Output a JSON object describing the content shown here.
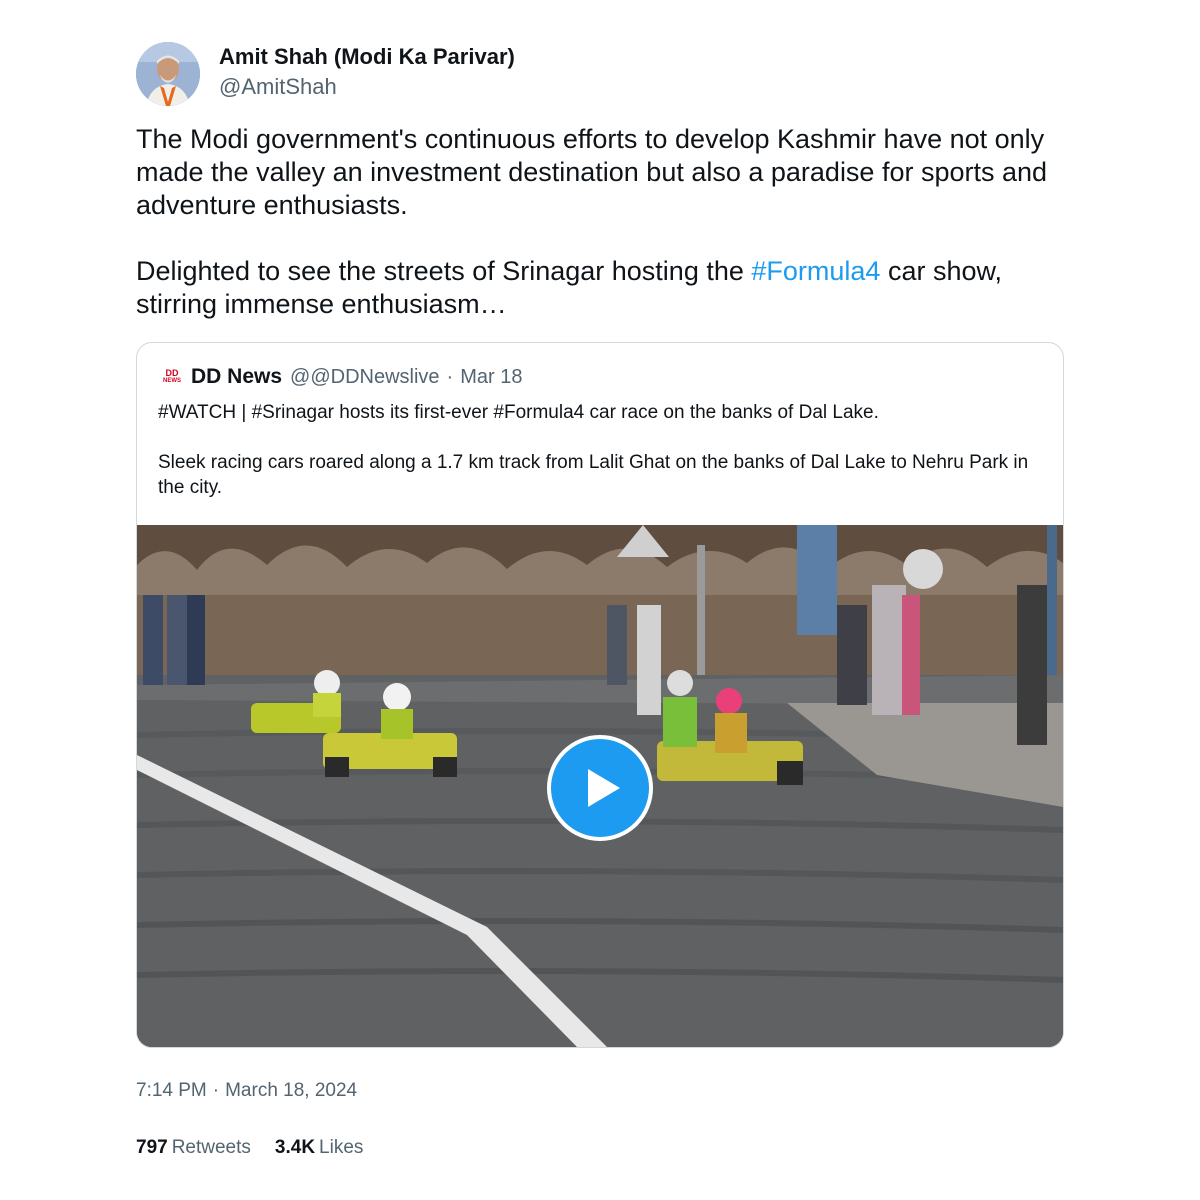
{
  "author": {
    "display_name": "Amit Shah (Modi Ka Parivar)",
    "handle": "@AmitShah",
    "avatar_icon": "profile-photo"
  },
  "tweet": {
    "paragraph1": "The Modi government's continuous efforts to develop Kashmir have not only made the valley an investment destination but also a paradise for sports and adventure enthusiasts.",
    "paragraph2_before": "Delighted to see the streets of Srinagar hosting the ",
    "paragraph2_hashtag": "#Formula4",
    "paragraph2_after": " car show, stirring immense enthusiasm…"
  },
  "quote": {
    "logo_top": "DD",
    "logo_bottom": "NEWS",
    "name": "DD News",
    "handle": "@@DDNewslive",
    "separator": "·",
    "date": "Mar 18",
    "text1": "#WATCH | #Srinagar hosts its first-ever #Formula4 car race on the banks of Dal Lake.",
    "text2": "Sleek racing cars roared along a 1.7 km track from Lalit Ghat on the banks of Dal Lake to Nehru Park in the city.",
    "media": {
      "type": "video",
      "play_icon": "play-icon"
    }
  },
  "meta": {
    "time": "7:14 PM",
    "separator": "·",
    "date": "March 18, 2024"
  },
  "stats": {
    "retweets_count": "797",
    "retweets_label": "Retweets",
    "likes_count": "3.4K",
    "likes_label": "Likes"
  },
  "colors": {
    "link": "#1d9bf0",
    "secondary_text": "#536471",
    "primary_text": "#0f1419",
    "border": "#cfd9de"
  }
}
